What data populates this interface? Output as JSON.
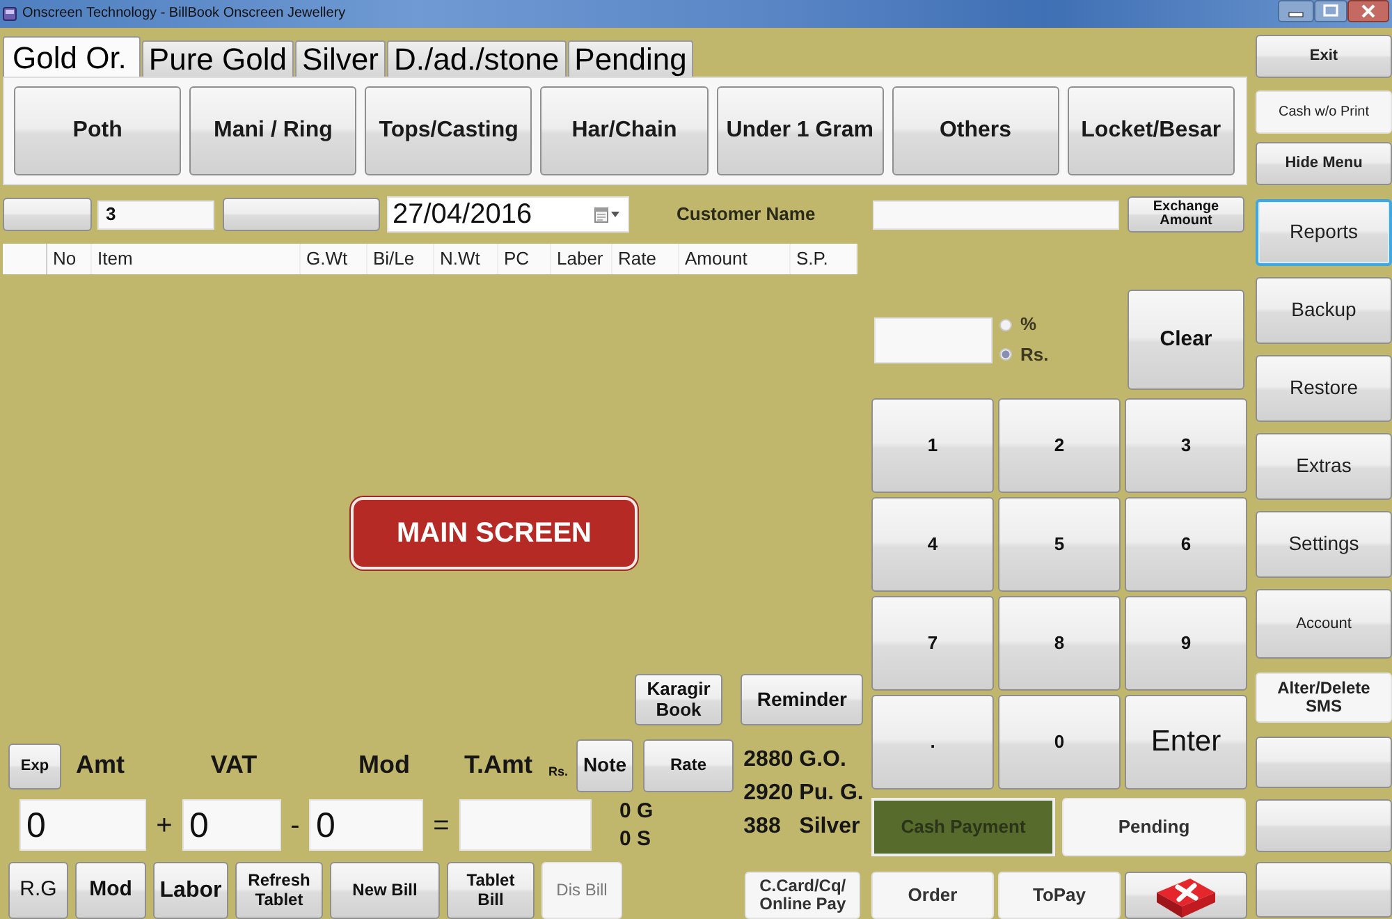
{
  "window": {
    "title": "Onscreen Technology - BillBook Onscreen Jewellery"
  },
  "tabs": [
    {
      "label": "Gold Or.",
      "selected": true
    },
    {
      "label": "Pure Gold",
      "selected": false
    },
    {
      "label": "Silver",
      "selected": false
    },
    {
      "label": "D./ad./stone",
      "selected": false
    },
    {
      "label": "Pending",
      "selected": false
    }
  ],
  "categories": [
    "Poth",
    "Mani / Ring",
    "Tops/Casting",
    "Har/Chain",
    "Under 1 Gram",
    "Others",
    "Locket/Besar"
  ],
  "bill_bar": {
    "number": "3",
    "date": "27/04/2016",
    "customer_label": "Customer Name",
    "exchange_button": "Exchange Amount"
  },
  "table": {
    "columns": [
      "No",
      "Item",
      "G.Wt",
      "Bi/Le",
      "N.Wt",
      "PC",
      "Laber",
      "Rate",
      "Amount",
      "S.P."
    ]
  },
  "screen_caption": "MAIN SCREEN",
  "entry_panel": {
    "karagir_button": "Karagir Book",
    "reminder_button": "Reminder",
    "exp_button": "Exp",
    "totals": [
      {
        "label": "Amt",
        "value": "0"
      },
      {
        "label": "VAT",
        "value": "0"
      },
      {
        "label": "Mod",
        "value": "0"
      },
      {
        "label": "T.Amt"
      }
    ],
    "currency_note": "Rs.",
    "note_button": "Note",
    "rate_button": "Rate",
    "operators": [
      "+",
      "-",
      "="
    ],
    "weights": [
      "0 G",
      "0 S"
    ],
    "metal_rates": [
      {
        "rate": "2880",
        "metal": "G.O."
      },
      {
        "rate": "2920",
        "metal": "Pu. G."
      },
      {
        "rate": "388",
        "metal": "Silver"
      }
    ],
    "actions": [
      {
        "label": "R.G",
        "disabled": false
      },
      {
        "label": "Mod",
        "disabled": false
      },
      {
        "label": "Labor",
        "disabled": false
      },
      {
        "label": "Refresh Tablet",
        "disabled": false
      },
      {
        "label": "New Bill",
        "disabled": false
      },
      {
        "label": "Tablet Bill",
        "disabled": false
      },
      {
        "label": "Dis Bill",
        "disabled": true
      }
    ],
    "card_button": "C.Card/Cq/ Online Pay"
  },
  "discount": {
    "options": [
      {
        "label": "%",
        "selected": false
      },
      {
        "label": "Rs.",
        "selected": true
      }
    ],
    "clear_button": "Clear"
  },
  "keypad": [
    "1",
    "2",
    "3",
    "4",
    "5",
    "6",
    "7",
    "8",
    "9",
    ".",
    "0",
    "Enter"
  ],
  "payment_modes": [
    {
      "label": "Cash Payment",
      "selected": true
    },
    {
      "label": "Pending",
      "selected": false
    }
  ],
  "bottom_buttons": [
    "Order",
    "ToPay"
  ],
  "side_menu": [
    {
      "label": "Exit",
      "kind": "raised",
      "focused": false
    },
    {
      "label": "Cash w/o Print",
      "kind": "flat",
      "focused": false
    },
    {
      "label": "Hide Menu",
      "kind": "raised",
      "focused": false
    },
    {
      "label": "Reports",
      "kind": "raised",
      "focused": true
    },
    {
      "label": "Backup",
      "kind": "raised",
      "focused": false
    },
    {
      "label": "Restore",
      "kind": "raised",
      "focused": false
    },
    {
      "label": "Extras",
      "kind": "raised",
      "focused": false
    },
    {
      "label": "Settings",
      "kind": "raised",
      "focused": false
    },
    {
      "label": "Account",
      "kind": "raised",
      "focused": false
    },
    {
      "label": "Alter/Delete SMS",
      "kind": "flat",
      "focused": false
    },
    {
      "kind": "raised",
      "focused": false
    },
    {
      "kind": "raised",
      "focused": false
    },
    {
      "kind": "raised",
      "focused": false
    }
  ]
}
